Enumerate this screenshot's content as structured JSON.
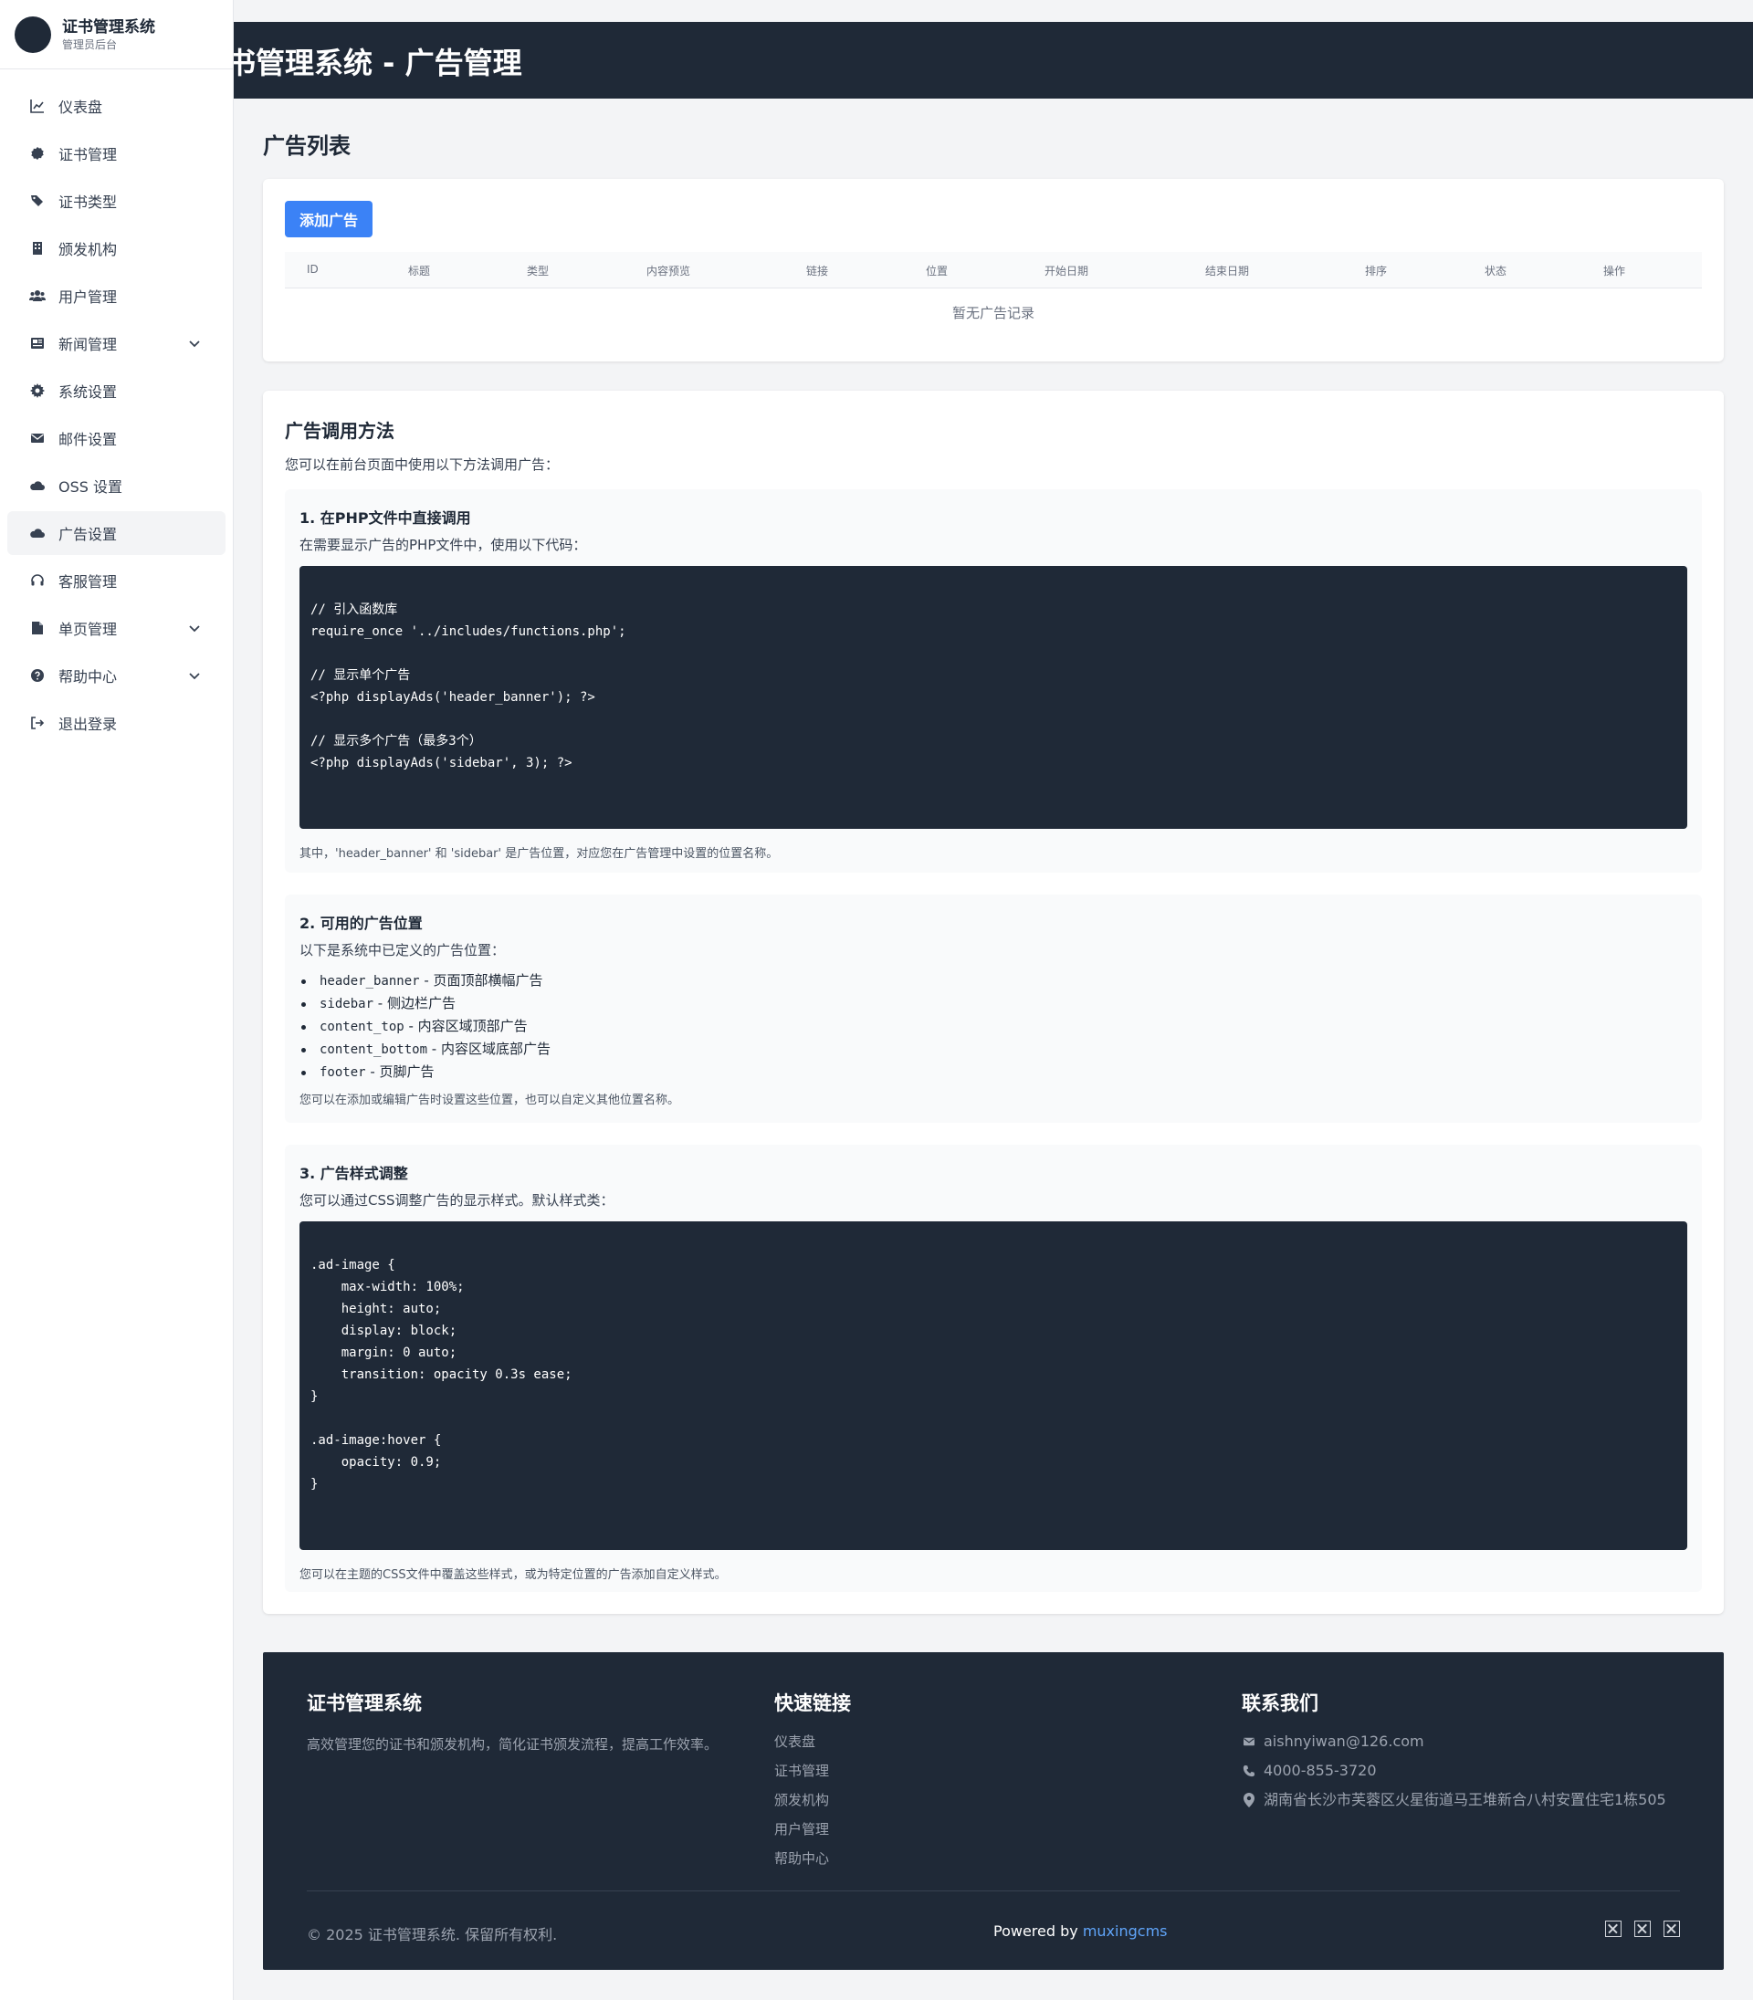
{
  "sidebar": {
    "brand_title": "证书管理系统",
    "brand_subtitle": "管理员后台",
    "items": [
      {
        "label": "仪表盘",
        "icon": "chart-line-icon"
      },
      {
        "label": "证书管理",
        "icon": "certificate-icon"
      },
      {
        "label": "证书类型",
        "icon": "tags-icon"
      },
      {
        "label": "颁发机构",
        "icon": "building-icon"
      },
      {
        "label": "用户管理",
        "icon": "users-icon"
      },
      {
        "label": "新闻管理",
        "icon": "newspaper-icon",
        "expandable": true
      },
      {
        "label": "系统设置",
        "icon": "gear-icon"
      },
      {
        "label": "邮件设置",
        "icon": "envelope-icon"
      },
      {
        "label": "OSS 设置",
        "icon": "cloud-icon"
      },
      {
        "label": "广告设置",
        "icon": "cloud-icon",
        "active": true
      },
      {
        "label": "客服管理",
        "icon": "headset-icon"
      },
      {
        "label": "单页管理",
        "icon": "file-icon",
        "expandable": true
      },
      {
        "label": "帮助中心",
        "icon": "question-circle-icon",
        "expandable": true
      },
      {
        "label": "退出登录",
        "icon": "sign-out-icon"
      }
    ]
  },
  "header": {
    "title": "证书管理系统 - 广告管理"
  },
  "main": {
    "page_title": "广告列表",
    "add_button": "添加广告",
    "table": {
      "columns": [
        "ID",
        "标题",
        "类型",
        "内容预览",
        "链接",
        "位置",
        "开始日期",
        "结束日期",
        "排序",
        "状态",
        "操作"
      ],
      "empty_text": "暂无广告记录"
    },
    "usage": {
      "title": "广告调用方法",
      "desc": "您可以在前台页面中使用以下方法调用广告：",
      "php": {
        "title": "1. 在PHP文件中直接调用",
        "desc": "在需要显示广告的PHP文件中，使用以下代码：",
        "code": [
          "// 引入函数库",
          "require_once '../includes/functions.php';",
          "",
          "// 显示单个广告",
          "<?php displayAds('header_banner'); ?>",
          "",
          "// 显示多个广告（最多3个）",
          "<?php displayAds('sidebar', 3); ?>"
        ],
        "note": "其中，'header_banner' 和 'sidebar' 是广告位置，对应您在广告管理中设置的位置名称。"
      },
      "positions": {
        "title": "2. 可用的广告位置",
        "desc": "以下是系统中已定义的广告位置：",
        "items": [
          {
            "code": "header_banner",
            "label": " - 页面顶部横幅广告"
          },
          {
            "code": "sidebar",
            "label": " - 侧边栏广告"
          },
          {
            "code": "content_top",
            "label": " - 内容区域顶部广告"
          },
          {
            "code": "content_bottom",
            "label": " - 内容区域底部广告"
          },
          {
            "code": "footer",
            "label": " - 页脚广告"
          }
        ],
        "note": "您可以在添加或编辑广告时设置这些位置，也可以自定义其他位置名称。"
      },
      "style": {
        "title": "3. 广告样式调整",
        "desc": "您可以通过CSS调整广告的显示样式。默认样式类：",
        "code": [
          ".ad-image {",
          "    max-width: 100%;",
          "    height: auto;",
          "    display: block;",
          "    margin: 0 auto;",
          "    transition: opacity 0.3s ease;",
          "}",
          "",
          ".ad-image:hover {",
          "    opacity: 0.9;",
          "}"
        ],
        "note": "您可以在主题的CSS文件中覆盖这些样式，或为特定位置的广告添加自定义样式。"
      }
    }
  },
  "footer": {
    "about_title": "证书管理系统",
    "about_text": "高效管理您的证书和颁发机构，简化证书颁发流程，提高工作效率。",
    "links_title": "快速链接",
    "links": [
      "仪表盘",
      "证书管理",
      "颁发机构",
      "用户管理",
      "帮助中心"
    ],
    "contact_title": "联系我们",
    "contact": [
      {
        "icon": "envelope-icon",
        "text": "aishnyiwan@126.com"
      },
      {
        "icon": "phone-icon",
        "text": "4000-855-3720"
      },
      {
        "icon": "map-marker-icon",
        "text": "湖南省长沙市芙蓉区火星街道马王堆新合八村安置住宅1栋505"
      }
    ],
    "copyright": "© 2025 证书管理系统. 保留所有权利.",
    "powered_prefix": "Powered by ",
    "powered_brand": "muxingcms",
    "social_icons": [
      "missing-glyph-icon",
      "missing-glyph-icon",
      "missing-glyph-icon"
    ]
  }
}
